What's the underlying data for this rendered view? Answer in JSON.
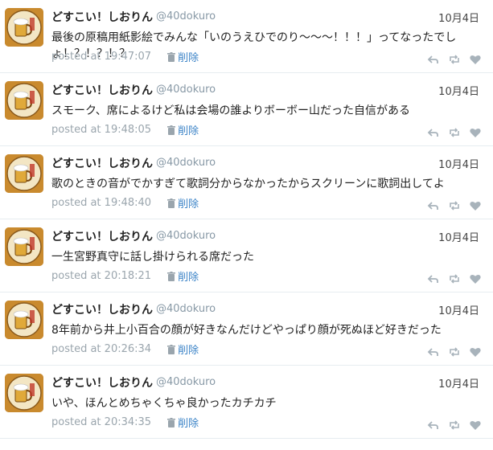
{
  "user": {
    "name": "どすこい！しおりん",
    "handle": "@40dokuro"
  },
  "labels": {
    "posted_prefix": "posted at",
    "delete": "削除"
  },
  "icons": {
    "avatar": "beer-mug-avatar-icon",
    "delete": "trash-icon",
    "reply": "reply-icon",
    "retweet": "retweet-icon",
    "like": "heart-icon"
  },
  "tweets": [
    {
      "date": "10月4日",
      "text": "最後の原稿用紙影絵でみんな「いのうえひでのり〜〜〜！！！」ってなったでしょ！？！？！？",
      "time": "19:47:07"
    },
    {
      "date": "10月4日",
      "text": "スモーク、席によるけど私は会場の誰よりボーボー山だった自信がある",
      "time": "19:48:05"
    },
    {
      "date": "10月4日",
      "text": "歌のときの音がでかすぎて歌詞分からなかったからスクリーンに歌詞出してよ",
      "time": "19:48:40"
    },
    {
      "date": "10月4日",
      "text": "一生宮野真守に話し掛けられる席だった",
      "time": "20:18:21"
    },
    {
      "date": "10月4日",
      "text": "8年前から井上小百合の顔が好きなんだけどやっぱり顔が死ぬほど好きだった",
      "time": "20:26:34"
    },
    {
      "date": "10月4日",
      "text": "いや、ほんとめちゃくちゃ良かったカチカチ",
      "time": "20:34:35"
    }
  ]
}
